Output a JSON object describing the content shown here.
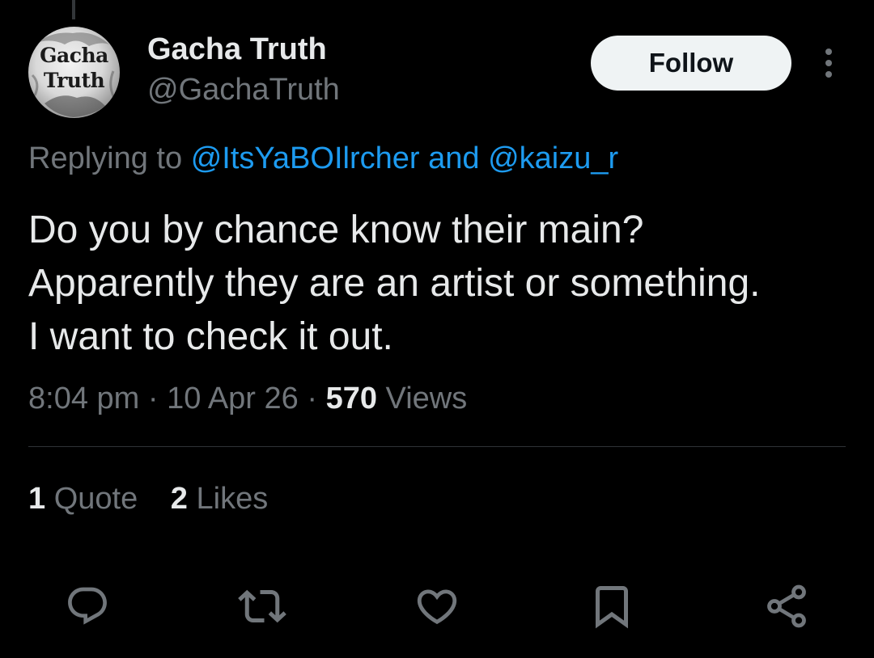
{
  "tweet": {
    "author": {
      "display_name": "Gacha Truth",
      "handle": "@GachaTruth",
      "avatar_line1": "Gacha",
      "avatar_line2": "Truth"
    },
    "follow_label": "Follow",
    "more_icon": "more-vertical-icon",
    "reply_prefix": "Replying to",
    "reply_mention_1": "@ItsYaBOIlrcher",
    "reply_joiner": "and",
    "reply_mention_2": "@kaizu_r",
    "text_lines": [
      "Do you by chance know their main?",
      "Apparently they are an artist or something.",
      "I want to check it out."
    ],
    "time": "8:04 pm",
    "date": "10 Apr 26",
    "separator": "·",
    "views_count": "570",
    "views_label": "Views",
    "quotes_count": "1",
    "quotes_label": "Quote",
    "likes_count": "2",
    "likes_label": "Likes"
  },
  "actions": [
    {
      "icon": "reply-icon"
    },
    {
      "icon": "retweet-icon"
    },
    {
      "icon": "like-heart-icon"
    },
    {
      "icon": "bookmark-icon"
    },
    {
      "icon": "share-icon"
    }
  ],
  "colors": {
    "background": "#000000",
    "primary_text": "#e7e9ea",
    "secondary_text": "#71767b",
    "link": "#1d9bf0",
    "follow_bg": "#eff3f4",
    "divider": "#2f3336"
  }
}
